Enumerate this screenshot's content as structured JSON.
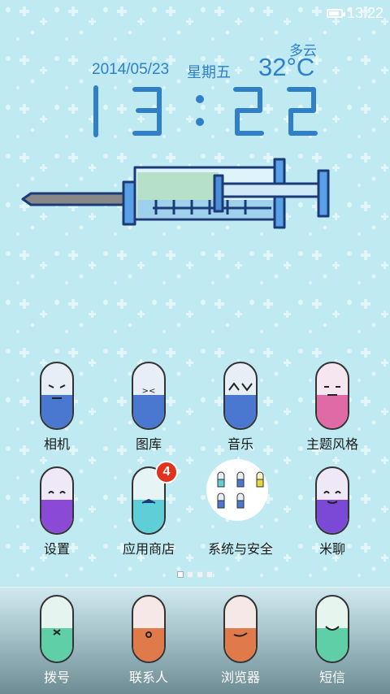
{
  "status_bar": {
    "time": "13:22",
    "battery_level": 0.85
  },
  "weather": {
    "description": "多云",
    "temperature": "32°C"
  },
  "clock": {
    "date": "2014/05/23",
    "weekday": "星期五",
    "time": "13:22"
  },
  "apps_row1": [
    {
      "label": "相机"
    },
    {
      "label": "图库"
    },
    {
      "label": "音乐"
    },
    {
      "label": "主题风格"
    }
  ],
  "apps_row2": [
    {
      "label": "设置"
    },
    {
      "label": "应用商店",
      "badge": "4"
    },
    {
      "label": "系统与安全"
    },
    {
      "label": "米聊"
    }
  ],
  "page_indicator": {
    "pages": 4,
    "current": 1
  },
  "dock": [
    {
      "label": "拨号"
    },
    {
      "label": "联系人"
    },
    {
      "label": "浏览器"
    },
    {
      "label": "短信"
    }
  ],
  "colors": {
    "background": "#bfeaf2",
    "accent_text": "#2f7fc9",
    "badge": "#e0331e"
  }
}
